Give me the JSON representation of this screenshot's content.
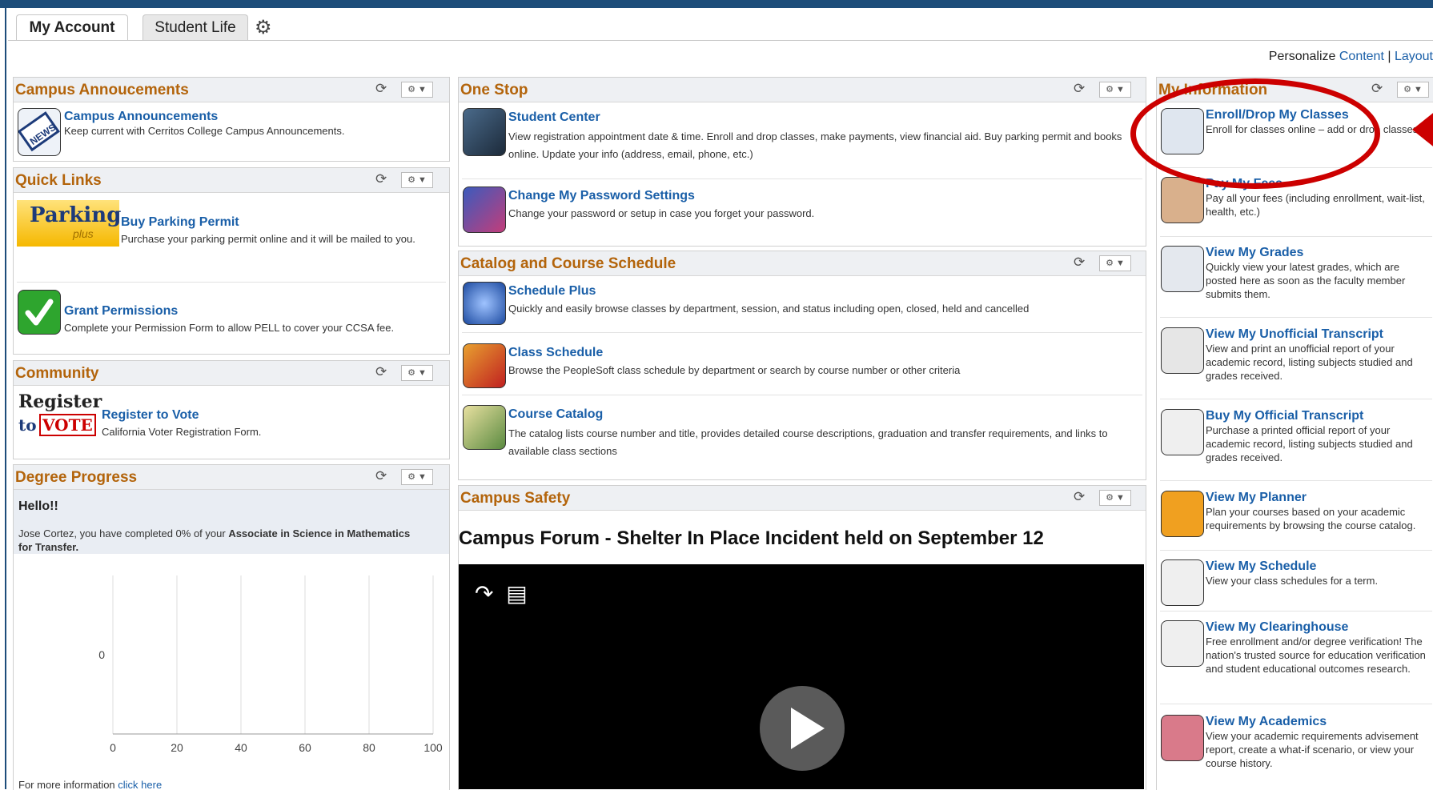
{
  "tabs": [
    {
      "label": "My Account"
    },
    {
      "label": "Student Life"
    }
  ],
  "personalize": {
    "prefix": "Personalize",
    "content": "Content",
    "sep": " | ",
    "layout": "Layout"
  },
  "announcements": {
    "title": "Campus Annoucements",
    "item": {
      "label": "Campus Announcements",
      "desc": "Keep current with Cerritos College Campus Announcements."
    }
  },
  "quick_links": {
    "title": "Quick Links",
    "items": [
      {
        "label": "Buy Parking Permit",
        "desc": "Purchase your parking permit online and it will be mailed to you.",
        "logo_text": "Parking",
        "logo_sub": "plus"
      },
      {
        "label": "Grant Permissions",
        "desc": "Complete your Permission Form to allow PELL to cover your CCSA fee."
      }
    ]
  },
  "community": {
    "title": "Community",
    "item": {
      "label": "Register to Vote",
      "desc": "California Voter Registration Form.",
      "logo_top": "Register",
      "logo_to": "to",
      "logo_vote": "VOTE"
    }
  },
  "degree": {
    "title": "Degree Progress",
    "hello": "Hello!!",
    "text_a": "Jose Cortez, you have completed 0% of your ",
    "text_b": "Associate in Science in Mathematics for Transfer.",
    "more_prefix": "For more information ",
    "more_link": "click here",
    "chart_data": {
      "type": "bar",
      "categories": [
        "0"
      ],
      "values": [
        0
      ],
      "xticks": [
        "0",
        "20",
        "40",
        "60",
        "80",
        "100"
      ],
      "xlim": [
        0,
        100
      ],
      "grid": true
    }
  },
  "one_stop": {
    "title": "One Stop",
    "items": [
      {
        "label": "Student Center",
        "desc": "View registration appointment date & time. Enroll and drop classes, make payments, view financial aid. Buy parking permit and books online. Update your info (address, email, phone, etc.)"
      },
      {
        "label": "Change My Password Settings",
        "desc": "Change your password or setup in case you forget your password."
      }
    ]
  },
  "catalog": {
    "title": "Catalog and Course Schedule",
    "items": [
      {
        "label": "Schedule Plus",
        "desc": "Quickly and easily browse classes by department, session, and status including open, closed, held and cancelled"
      },
      {
        "label": "Class Schedule",
        "desc": "Browse the PeopleSoft class schedule by department or search by course number or other criteria"
      },
      {
        "label": "Course Catalog",
        "desc": "The catalog lists course number and title, provides detailed course descriptions, graduation and transfer requirements, and links to available class sections"
      }
    ]
  },
  "safety": {
    "title": "Campus Safety",
    "video_title": "Campus Forum - Shelter In Place Incident held on September 12"
  },
  "my_info": {
    "title": "My Information",
    "items": [
      {
        "label": "Enroll/Drop My Classes",
        "desc": "Enroll for classes online – add or drop classes."
      },
      {
        "label": "Pay My Fees",
        "desc": "Pay all your fees (including enrollment, wait-list, health, etc.)"
      },
      {
        "label": "View My Grades",
        "desc": "Quickly view your latest grades, which are posted here as soon as the faculty member submits them."
      },
      {
        "label": "View My Unofficial Transcript",
        "desc": "View and print an unofficial report of your academic record, listing subjects studied and grades received."
      },
      {
        "label": "Buy My Official Transcript",
        "desc": "Purchase a printed official report of your academic record, listing subjects studied and grades received."
      },
      {
        "label": "View My Planner",
        "desc": "Plan your courses based on your academic requirements by browsing the course catalog."
      },
      {
        "label": "View My Schedule",
        "desc": "View your class schedules for a term."
      },
      {
        "label": "View My Clearinghouse",
        "desc": "Free enrollment and/or degree verification! The nation's trusted source for education verification and student educational outcomes research."
      },
      {
        "label": "View My Academics",
        "desc": "View your academic requirements advisement report, create a what-if scenario, or view your course history."
      }
    ]
  },
  "colors": {
    "header_text": "#b3640b",
    "link": "#1a5fa8",
    "callout": "#cc0000"
  }
}
